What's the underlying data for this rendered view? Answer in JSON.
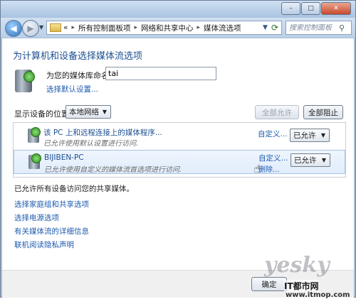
{
  "window": {
    "controls": {
      "minimize": "–",
      "maximize": "□",
      "close": "✕"
    }
  },
  "nav": {
    "overflow": "«",
    "breadcrumbs": [
      "所有控制面板项",
      "网络和共享中心",
      "媒体流选项"
    ],
    "search_placeholder": "搜索控制面板"
  },
  "page": {
    "title": "为计算机和设备选择媒体流选项",
    "library_label": "为您的媒体库命名:",
    "library_value": "tai",
    "default_settings_link": "选择默认设置...",
    "show_devices_label": "显示设备的位置:",
    "network_select": "本地网络",
    "allow_all": "全部允许",
    "block_all": "全部阻止"
  },
  "devices": [
    {
      "name": "该 PC 上和远程连接上的媒体程序...",
      "desc": "已允许使用默认设置进行访问.",
      "customize": "自定义...",
      "access": "已允许"
    },
    {
      "name": "BIJIBEN-PC",
      "desc": "已允许使用自定义的媒体流首选项进行访问.",
      "customize": "自定义...",
      "remove": "删除...",
      "access": "已允许"
    }
  ],
  "status_note": "已允许所有设备访问您的共享媒体。",
  "links": [
    "选择家庭组和共享选项",
    "选择电源选项",
    "有关媒体流的详细信息",
    "联机阅读隐私声明"
  ],
  "footer": {
    "ok": "确定"
  },
  "watermark": {
    "brand": "yesky",
    "site": "IT都市网",
    "url": "www.itmop.com"
  }
}
